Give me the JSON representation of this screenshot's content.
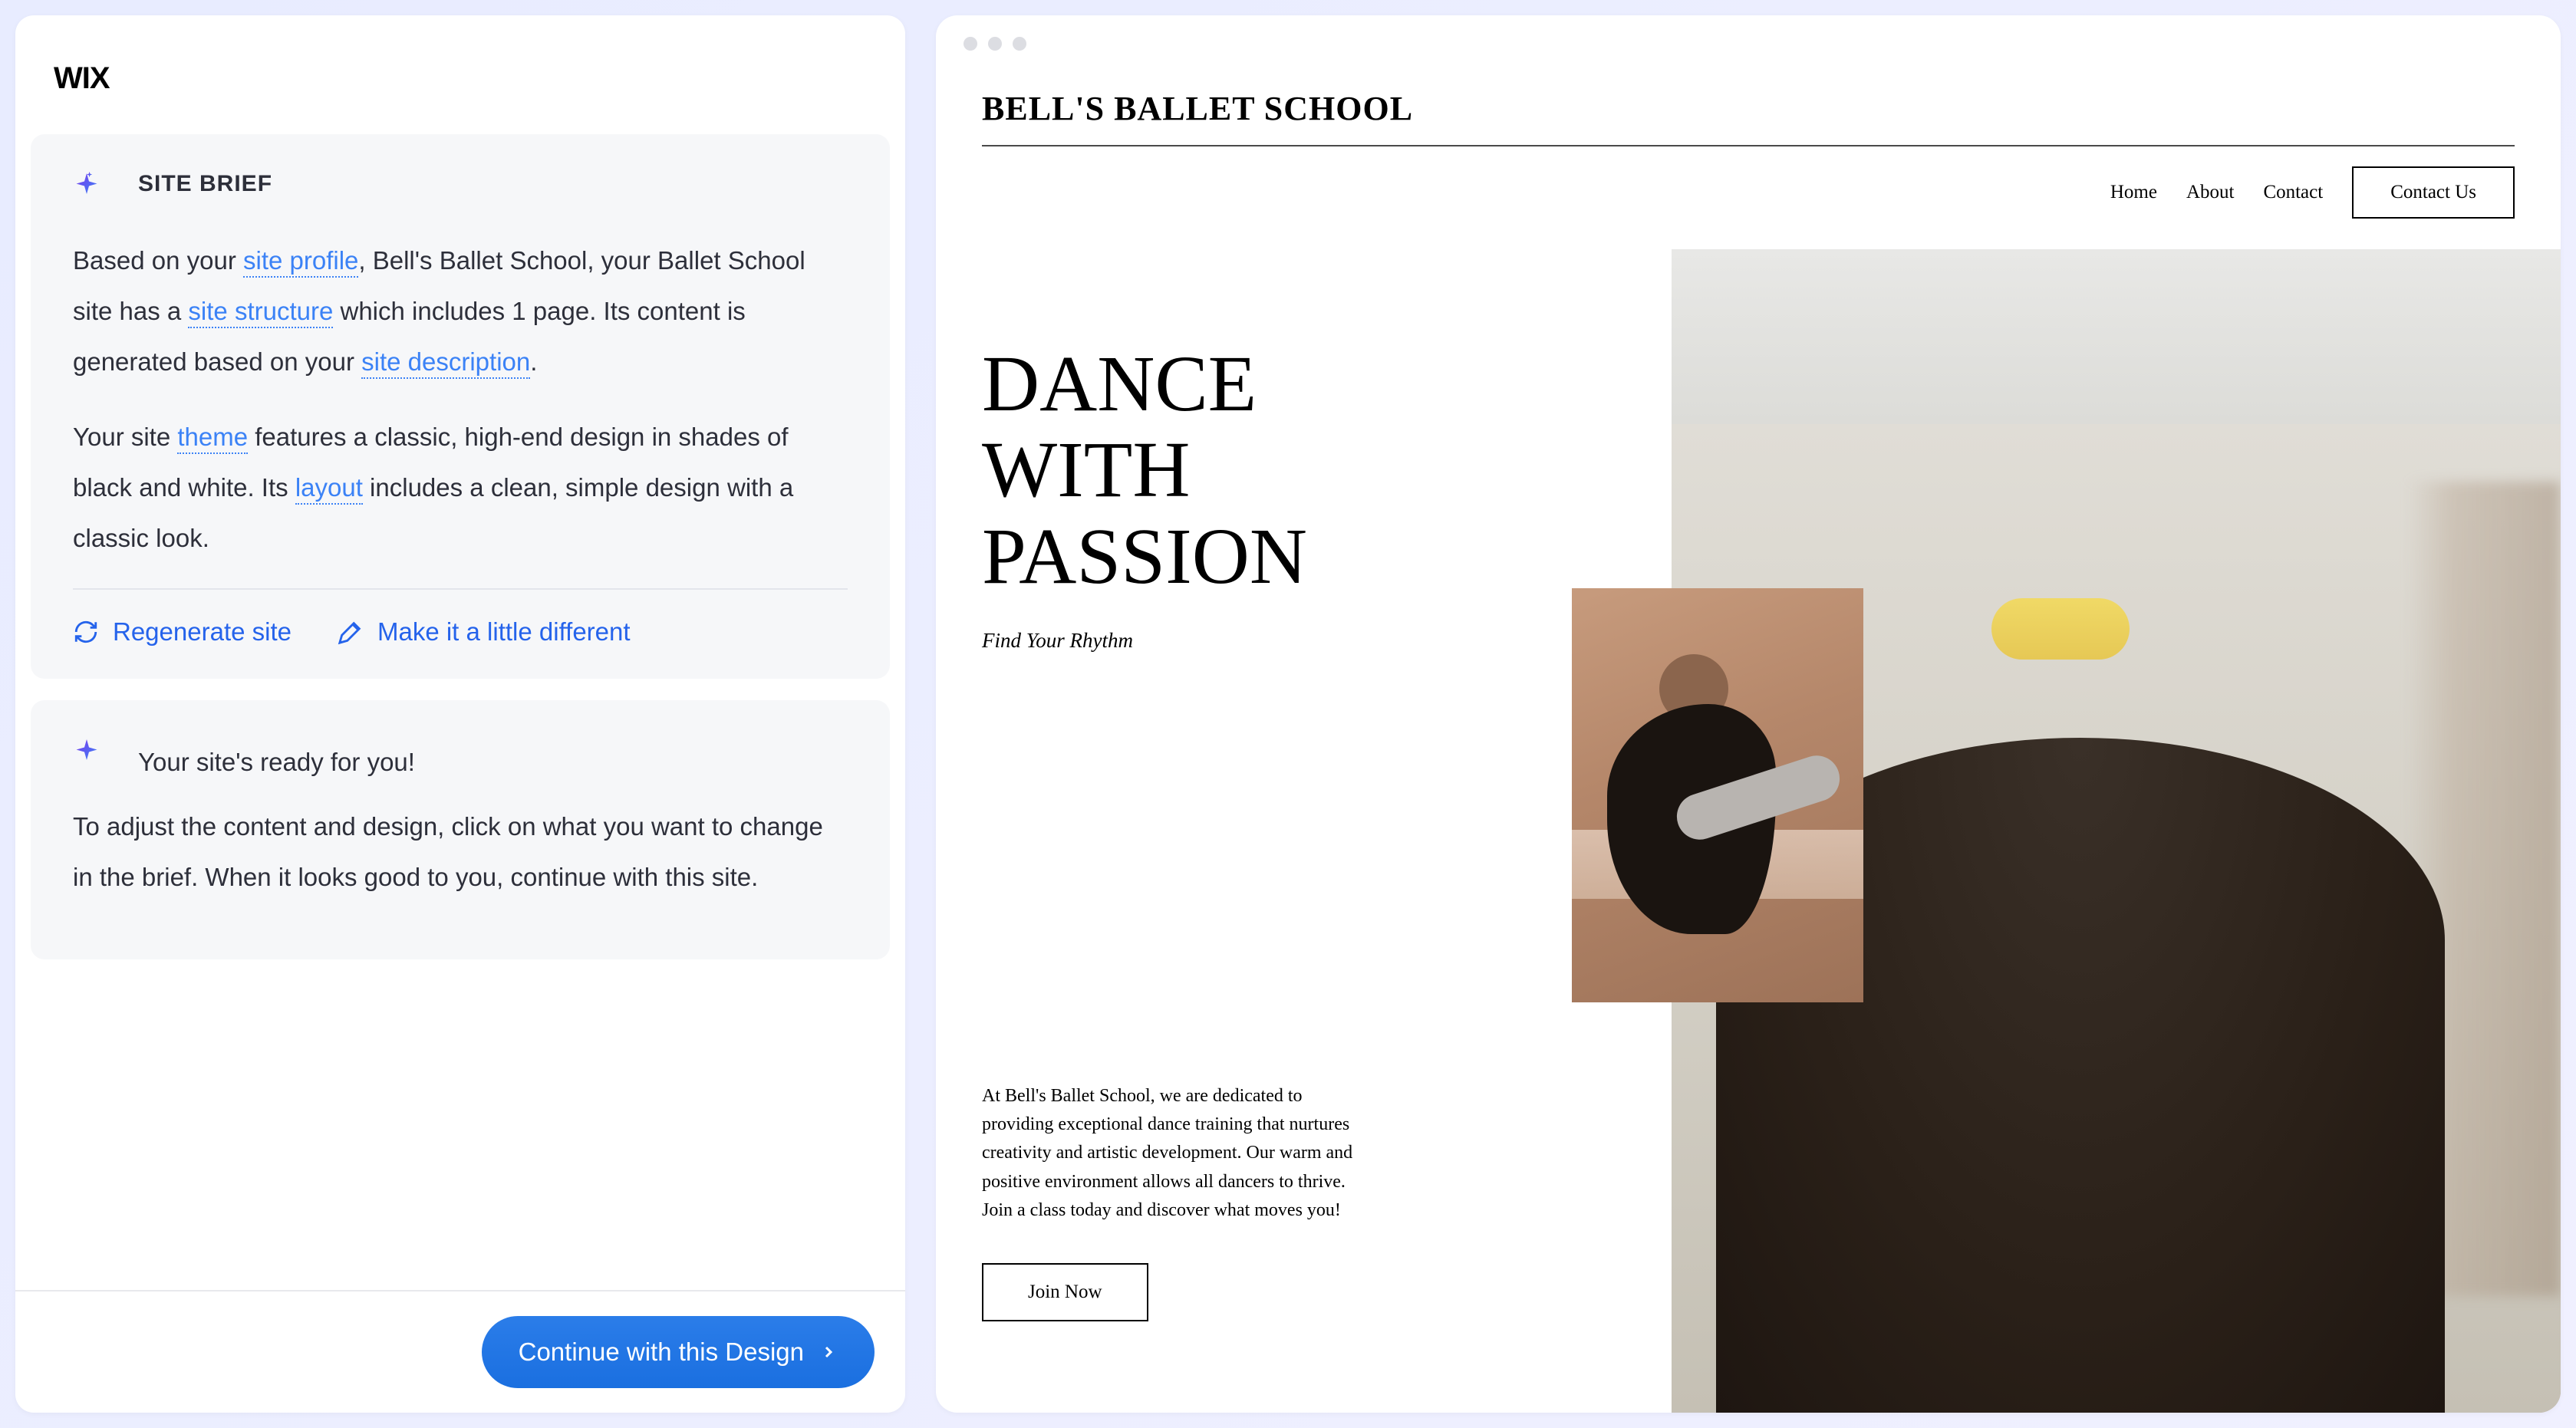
{
  "logo": "WIX",
  "site_brief": {
    "title": "SITE BRIEF",
    "p1_parts": {
      "t1": "Based on your ",
      "link1": "site profile",
      "t2": ", Bell's Ballet School, your Ballet School site has a ",
      "link2": "site structure",
      "t3": " which includes 1 page. Its content is generated based on your ",
      "link3": "site description",
      "t4": "."
    },
    "p2_parts": {
      "t1": "Your site ",
      "link1": "theme",
      "t2": " features a classic, high-end design in shades of black and white. Its ",
      "link2": "layout",
      "t3": " includes a clean, simple design with a classic look."
    },
    "actions": {
      "regenerate": "Regenerate site",
      "different": "Make it a little different"
    }
  },
  "ready": {
    "heading": "Your site's ready for you!",
    "body": "To adjust the content and design, click on what you want to change in the brief. When it looks good to you, continue with this site."
  },
  "continue_btn": "Continue with this Design",
  "preview": {
    "site_name": "BELL'S BALLET SCHOOL",
    "nav": {
      "home": "Home",
      "about": "About",
      "contact": "Contact",
      "contact_btn": "Contact Us"
    },
    "hero": {
      "line1": "DANCE",
      "line2": "WITH",
      "line3": "PASSION",
      "subtitle": "Find Your Rhythm",
      "description": "At Bell's Ballet School, we are dedicated to providing exceptional dance training that nurtures creativity and artistic development. Our warm and positive environment allows all dancers to thrive. Join a class today and discover what moves you!",
      "cta": "Join Now"
    }
  }
}
